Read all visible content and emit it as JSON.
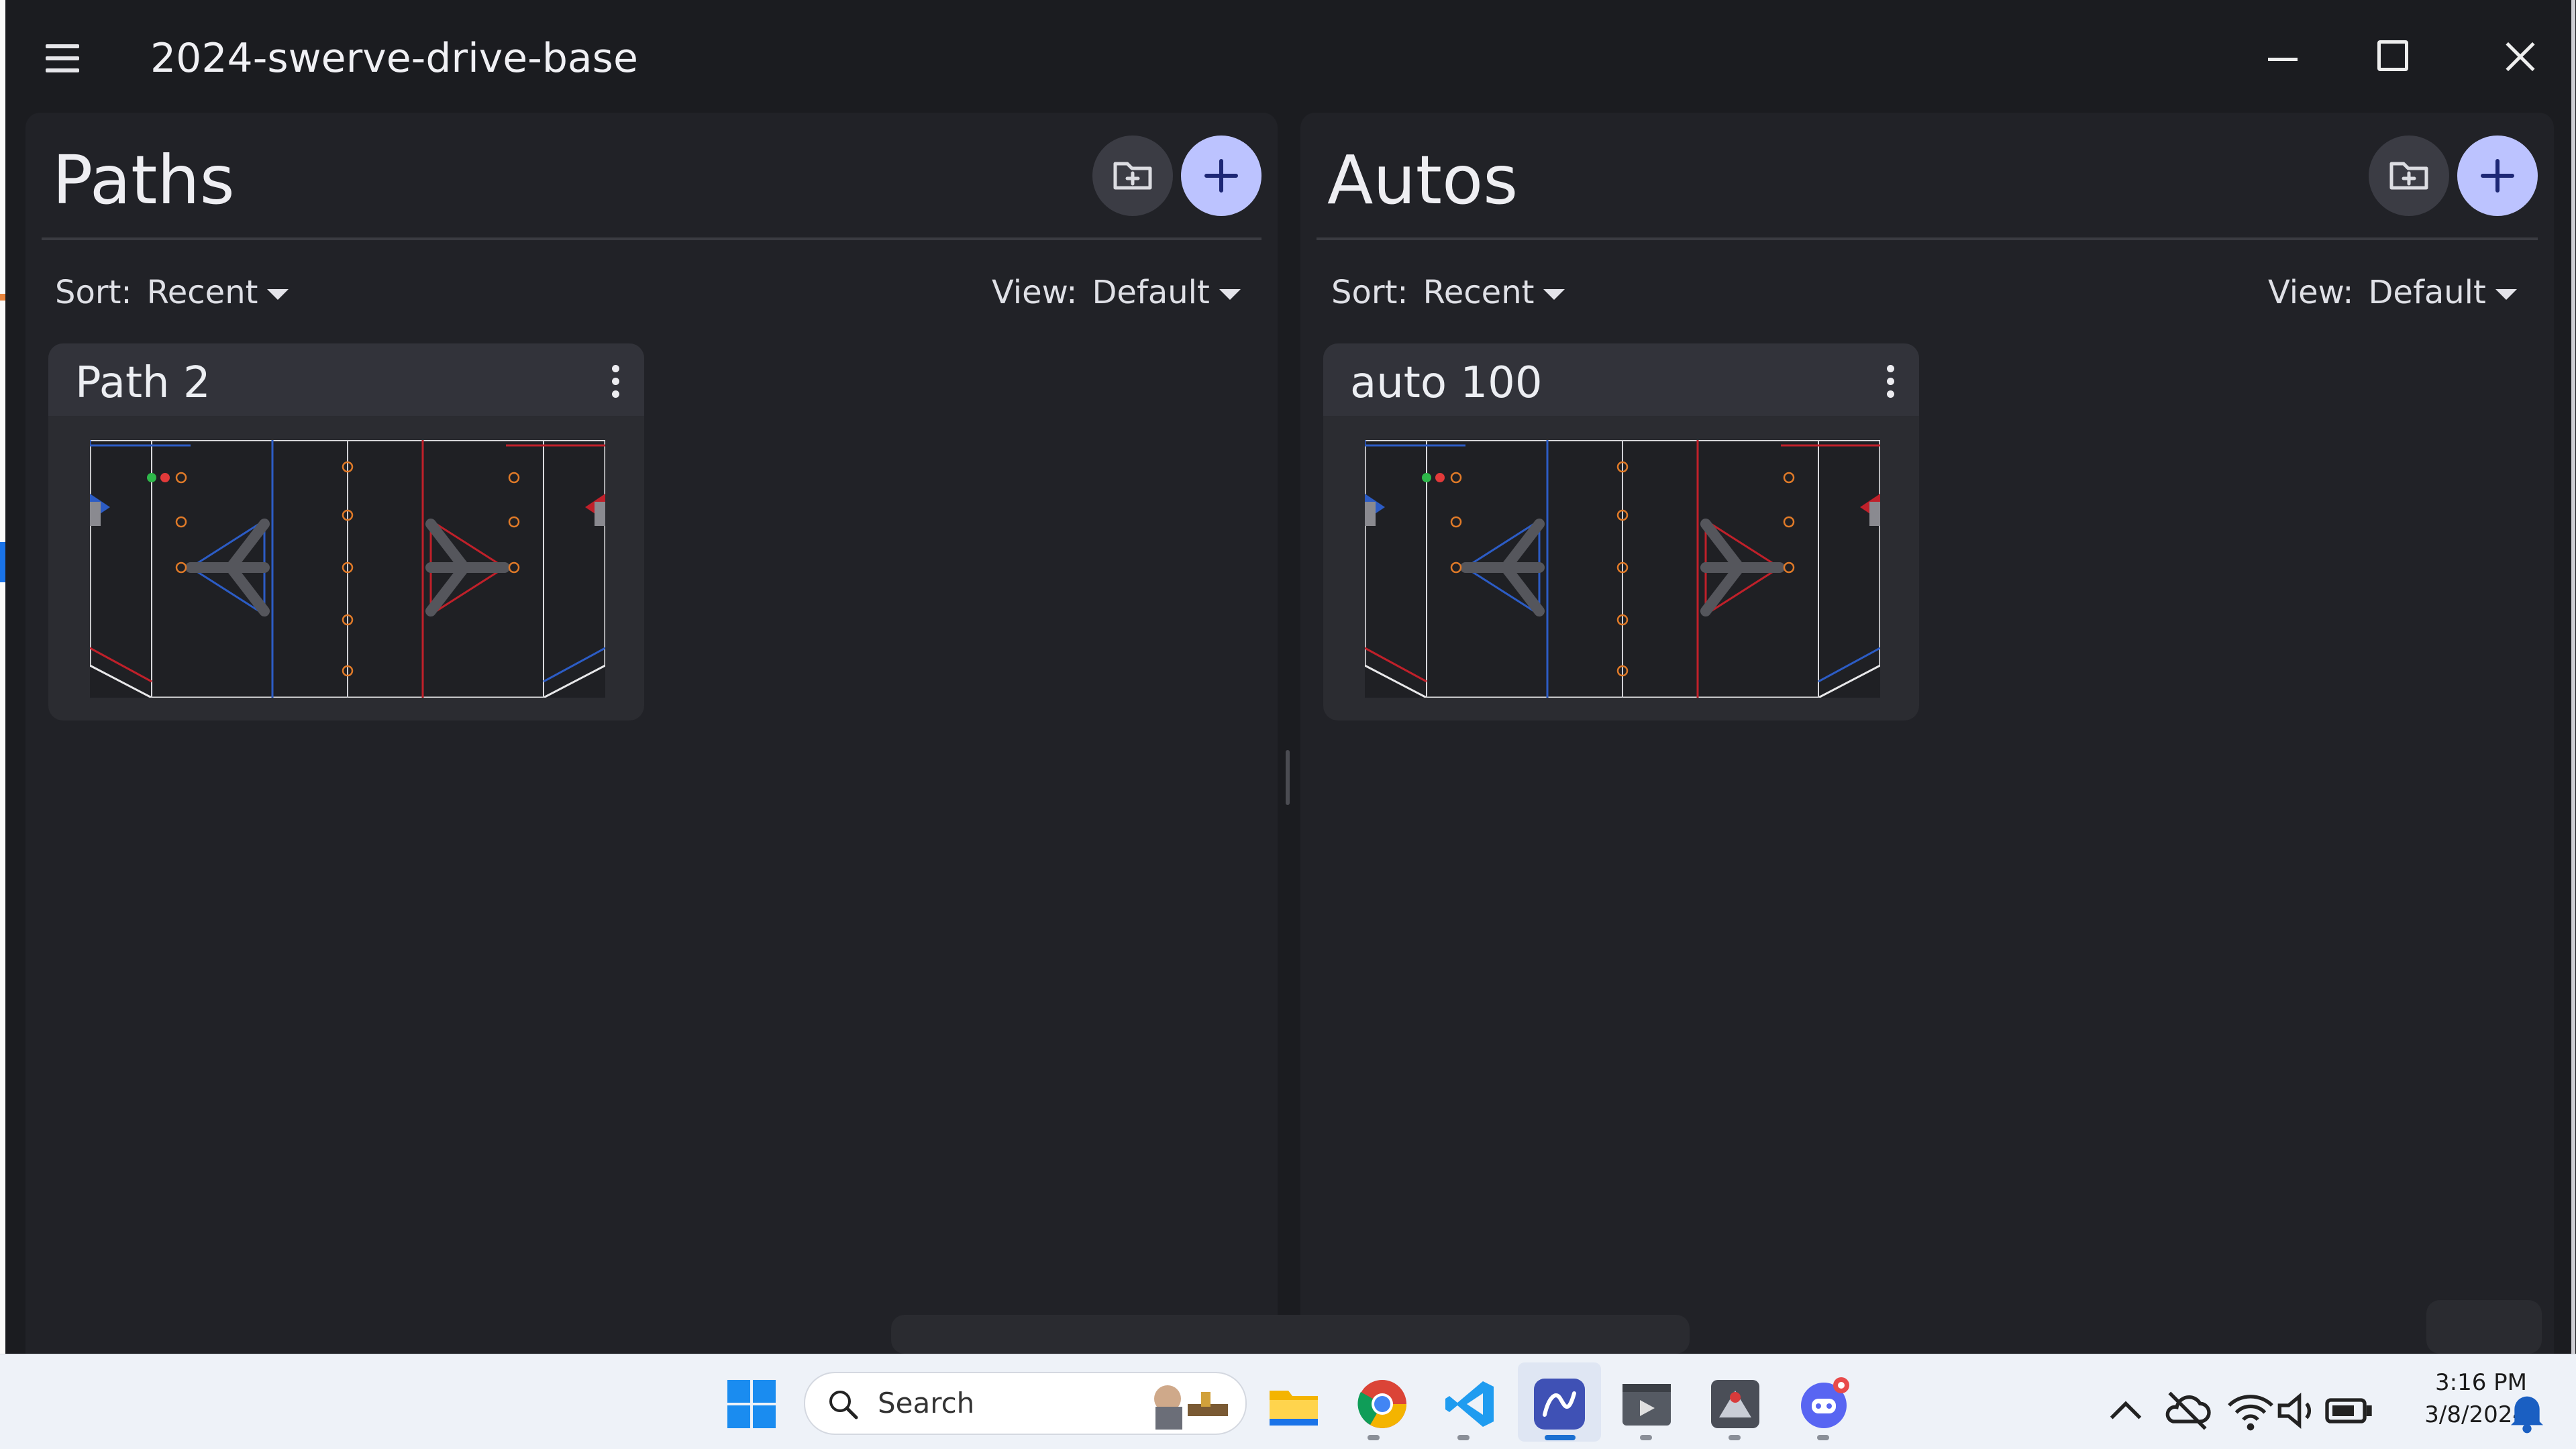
{
  "window": {
    "title": "2024-swerve-drive-base"
  },
  "paths_panel": {
    "title": "Paths",
    "sort_label": "Sort:",
    "sort_value": "Recent",
    "view_label": "View:",
    "view_value": "Default",
    "items": [
      {
        "name": "Path 2"
      }
    ]
  },
  "autos_panel": {
    "title": "Autos",
    "sort_label": "Sort:",
    "sort_value": "Recent",
    "view_label": "View:",
    "view_value": "Default",
    "items": [
      {
        "name": "auto 100"
      }
    ]
  },
  "taskbar": {
    "search_placeholder": "Search",
    "time": "3:16 PM",
    "date": "3/8/2024",
    "pinned_icons": [
      "windows-start-icon",
      "file-explorer-icon",
      "chrome-icon",
      "vscode-icon",
      "pathplanner-icon",
      "terminal-app-icon",
      "java-app-icon",
      "discord-icon"
    ]
  },
  "colors": {
    "accent": "#bcc3ff",
    "background": "#1b1c20",
    "panel": "#212227",
    "card": "#2b2c31",
    "blue_alliance": "#2c5cc5",
    "red_alliance": "#c0202a",
    "note_orange": "#e07a28"
  }
}
